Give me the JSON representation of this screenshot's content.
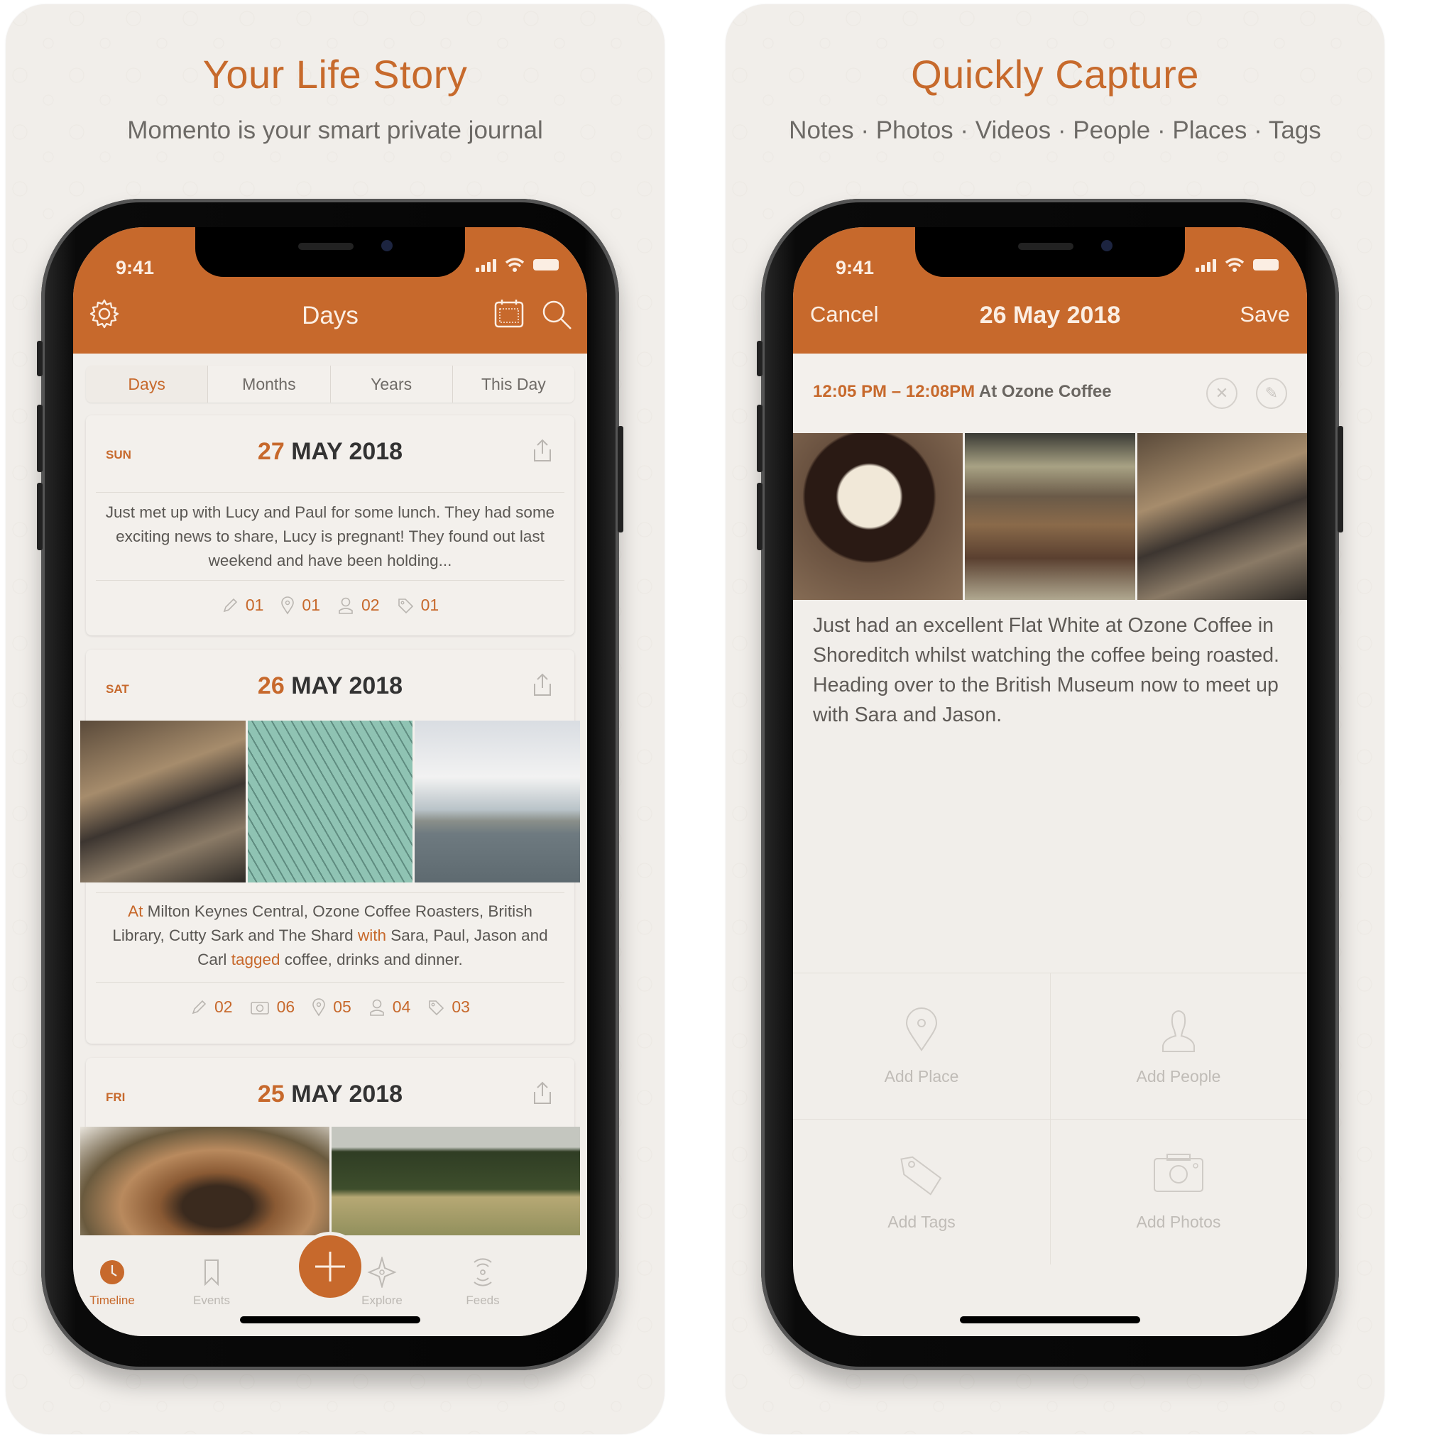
{
  "panels": [
    {
      "headline": "Your Life Story",
      "subline": "Momento is your smart private journal"
    },
    {
      "headline": "Quickly Capture",
      "subline": "Notes · Photos · Videos · People · Places · Tags"
    }
  ],
  "timeline_screen": {
    "status_time": "9:41",
    "nav_title": "Days",
    "nav_icons": [
      "gear-icon",
      "calendar-icon",
      "search-icon"
    ],
    "segments": [
      {
        "label": "Days",
        "active": true
      },
      {
        "label": "Months",
        "active": false
      },
      {
        "label": "Years",
        "active": false
      },
      {
        "label": "This Day",
        "active": false
      }
    ],
    "cards": [
      {
        "dow": "SUN",
        "day": "27",
        "month_year": "MAY 2018",
        "body": "Just met up with Lucy and Paul for some lunch. They had some exciting news to share, Lucy is pregnant! They found out last weekend and have been holding...",
        "stats": [
          {
            "icon": "pencil-icon",
            "value": "01"
          },
          {
            "icon": "pin-icon",
            "value": "01"
          },
          {
            "icon": "person-icon",
            "value": "02"
          },
          {
            "icon": "tag-icon",
            "value": "01"
          }
        ]
      },
      {
        "dow": "SAT",
        "day": "26",
        "month_year": "MAY 2018",
        "photos": [
          "cafe counter crowd",
          "British Museum glass roof",
          "pigeon on river pier"
        ],
        "body_parts": {
          "at": "At",
          "places": "Milton Keynes Central, Ozone Coffee Roasters, British Library, Cutty Sark and The Shard",
          "with": "with",
          "people": "Sara, Paul, Jason and Carl",
          "tagged": "tagged",
          "tags": "coffee, drinks and dinner."
        },
        "stats": [
          {
            "icon": "pencil-icon",
            "value": "02"
          },
          {
            "icon": "camera-icon",
            "value": "06"
          },
          {
            "icon": "pin-icon",
            "value": "05"
          },
          {
            "icon": "person-icon",
            "value": "04"
          },
          {
            "icon": "tag-icon",
            "value": "03"
          }
        ]
      },
      {
        "dow": "FRI",
        "day": "25",
        "month_year": "MAY 2018",
        "photos": [
          "dog close-up",
          "park with trees"
        ]
      }
    ],
    "tabs": [
      {
        "label": "Timeline",
        "active": true
      },
      {
        "label": "Events",
        "active": false
      },
      {
        "label": "Explore",
        "active": false
      },
      {
        "label": "Feeds",
        "active": false
      }
    ],
    "add_button": "+"
  },
  "capture_screen": {
    "status_time": "9:41",
    "cancel": "Cancel",
    "title": "26 May 2018",
    "save": "Save",
    "event_time": "12:05 PM – 12:08PM",
    "event_place": "At Ozone Coffee",
    "photos": [
      "flat white coffee cup",
      "cafe long table",
      "cafe counter crowd"
    ],
    "note": "Just had an excellent Flat White at Ozone Coffee in Shoreditch whilst watching the coffee being roasted. Heading over to the British Museum now to meet up with Sara and Jason.",
    "actions": [
      {
        "label": "Add Place",
        "icon": "pin-icon"
      },
      {
        "label": "Add People",
        "icon": "person-icon"
      },
      {
        "label": "Add Tags",
        "icon": "tag-icon"
      },
      {
        "label": "Add Photos",
        "icon": "camera-icon"
      }
    ]
  },
  "colors": {
    "accent": "#c7692c",
    "background": "#f1eeea",
    "text": "#5a5753"
  }
}
